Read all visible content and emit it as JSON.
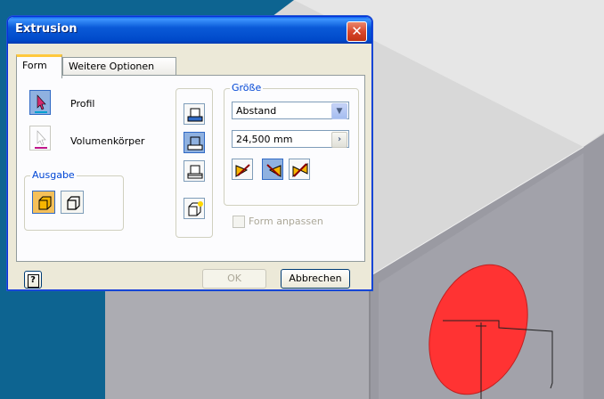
{
  "dialog": {
    "title": "Extrusion",
    "close_glyph": "✕",
    "tabs": [
      {
        "label": "Form",
        "active": true
      },
      {
        "label": "Weitere Optionen",
        "active": false
      }
    ],
    "form": {
      "profile_label": "Profil",
      "solid_label": "Volumenkörper",
      "output_group": "Ausgabe",
      "size_group": "Größe",
      "extent_value": "Abstand",
      "distance_value": "24,500 mm",
      "match_shape_label": "Form anpassen",
      "match_shape_checked": false
    },
    "footer": {
      "help_glyph": "?",
      "ok_label": "OK",
      "cancel_label": "Abbrechen"
    }
  },
  "colors": {
    "accent": "#316ac5",
    "profile_fill": "#ff3333",
    "viewport_bg": "#0d6491"
  },
  "icons": [
    "profile-select-icon",
    "solid-select-icon",
    "output-solid-icon",
    "output-surface-icon",
    "join-icon",
    "cut-icon",
    "intersect-icon",
    "new-solid-icon",
    "direction-1-icon",
    "direction-2-icon",
    "symmetric-icon",
    "dropdown-arrow-icon",
    "expand-arrow-icon",
    "help-icon",
    "close-icon"
  ]
}
